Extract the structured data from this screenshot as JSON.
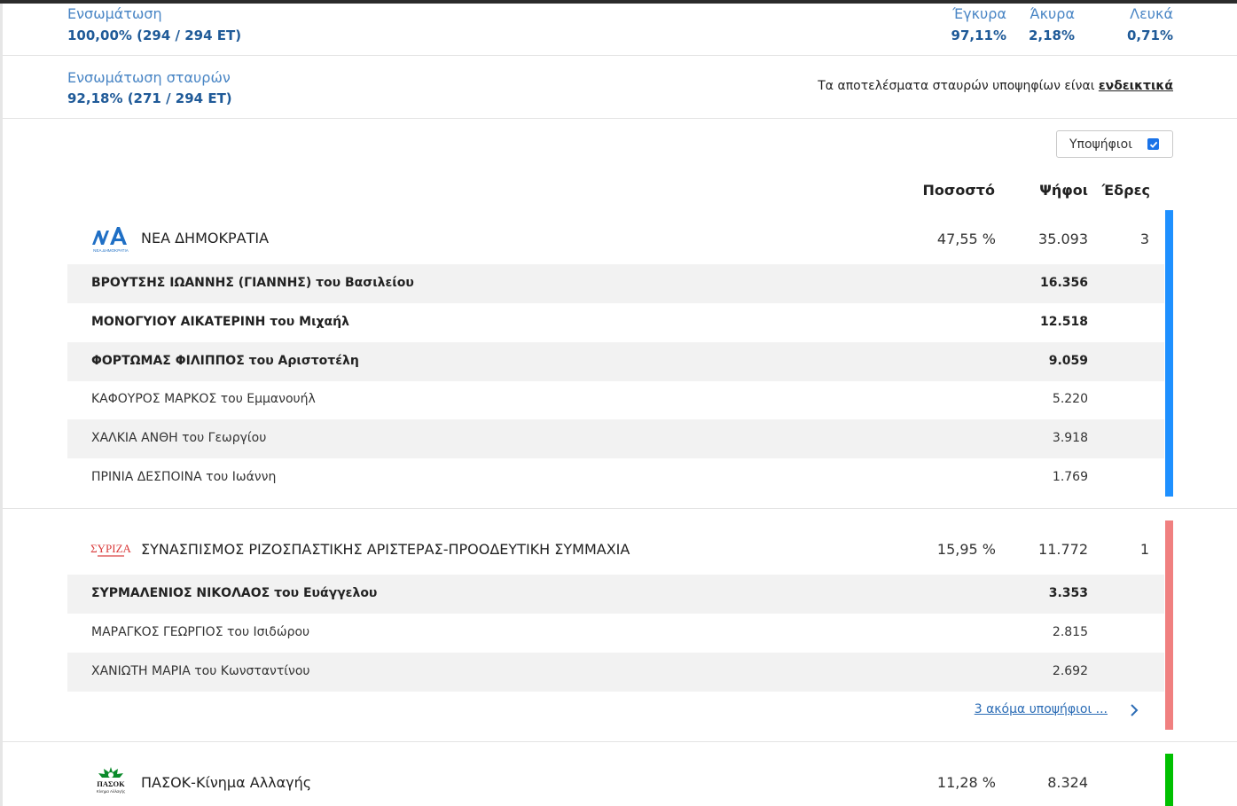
{
  "header": {
    "integration_label": "Ενσωμάτωση",
    "integration_value": "100,00% (294 / 294 ΕΤ)",
    "valid_label": "Έγκυρα",
    "valid_value": "97,11%",
    "invalid_label": "Άκυρα",
    "invalid_value": "2,18%",
    "blank_label": "Λευκά",
    "blank_value": "0,71%",
    "cross_label": "Ενσωμάτωση σταυρών",
    "cross_value": "92,18% (271 / 294 ΕΤ)",
    "note_text": "Τα αποτελέσματα σταυρών υποψηφίων είναι ",
    "note_link": "ενδεικτικά"
  },
  "toggle": {
    "label": "Υποψήφιοι",
    "checked": true
  },
  "columns": {
    "percent": "Ποσοστό",
    "votes": "Ψήφοι",
    "seats": "Έδρες"
  },
  "parties": [
    {
      "name": "ΝΕΑ ΔΗΜΟΚΡΑΤΙΑ",
      "logo": "nd-logo-icon",
      "logo_subtext": "ΝΕΑ ΔΗΜΟΚΡΑΤΙΑ",
      "percent": "47,55 %",
      "votes": "35.093",
      "seats": "3",
      "color": "#1e90ff",
      "candidates": [
        {
          "name": "ΒΡΟΥΤΣΗΣ ΙΩΑΝΝΗΣ (ΓΙΑΝΝΗΣ) του Βασιλείου",
          "votes": "16.356",
          "elected": true
        },
        {
          "name": "ΜΟΝΟΓΥΙΟΥ ΑΙΚΑΤΕΡΙΝΗ του Μιχαήλ",
          "votes": "12.518",
          "elected": true
        },
        {
          "name": "ΦΟΡΤΩΜΑΣ ΦΙΛΙΠΠΟΣ του Αριστοτέλη",
          "votes": "9.059",
          "elected": true
        },
        {
          "name": "ΚΑΦΟΥΡΟΣ ΜΑΡΚΟΣ του Εμμανουήλ",
          "votes": "5.220",
          "elected": false
        },
        {
          "name": "ΧΑΛΚΙΑ ΑΝΘΗ του Γεωργίου",
          "votes": "3.918",
          "elected": false
        },
        {
          "name": "ΠΡΙΝΙΑ ΔΕΣΠΟΙΝΑ του Ιωάννη",
          "votes": "1.769",
          "elected": false
        }
      ]
    },
    {
      "name": "ΣΥΝΑΣΠΙΣΜΟΣ ΡΙΖΟΣΠΑΣΤΙΚΗΣ ΑΡΙΣΤΕΡΑΣ-ΠΡΟΟΔΕΥΤΙΚΗ ΣΥΜΜΑΧΙΑ",
      "logo": "syriza-logo-icon",
      "logo_text": "ΣΥΡΙΖΑ",
      "percent": "15,95 %",
      "votes": "11.772",
      "seats": "1",
      "color": "#f08080",
      "candidates": [
        {
          "name": "ΣΥΡΜΑΛΕΝΙΟΣ ΝΙΚΟΛΑΟΣ του Ευάγγελου",
          "votes": "3.353",
          "elected": true
        },
        {
          "name": "ΜΑΡΑΓΚΟΣ ΓΕΩΡΓΙΟΣ του Ισιδώρου",
          "votes": "2.815",
          "elected": false
        },
        {
          "name": "ΧΑΝΙΩΤΗ ΜΑΡΙΑ του Κωνσταντίνου",
          "votes": "2.692",
          "elected": false
        }
      ],
      "more_link": "3 ακόμα υποψήφιοι ..."
    },
    {
      "name": "ΠΑΣΟΚ-Κίνημα Αλλαγής",
      "logo": "pasok-logo-icon",
      "logo_text": "ΠΑΣΟΚ",
      "logo_subtext": "Κίνημα Αλλαγής",
      "percent": "11,28 %",
      "votes": "8.324",
      "seats": "",
      "color": "#00c000"
    }
  ]
}
